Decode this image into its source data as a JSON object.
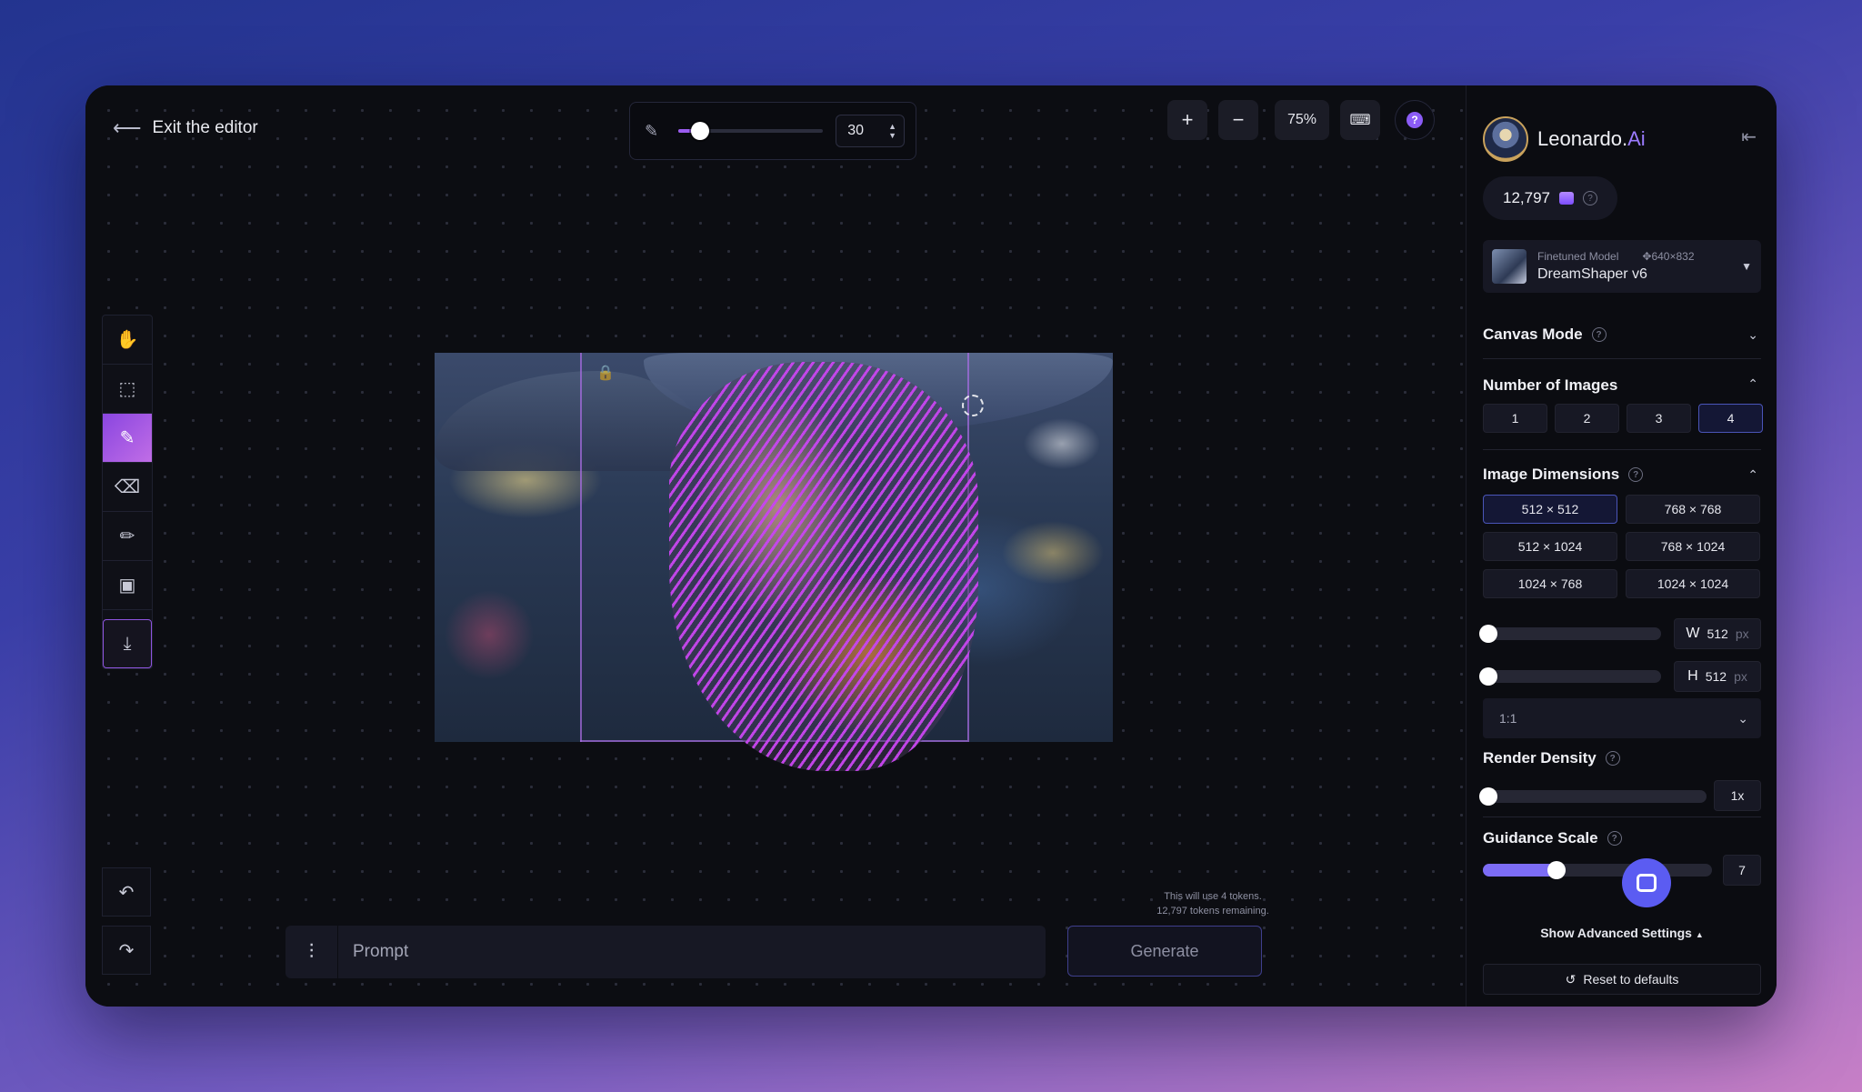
{
  "header": {
    "exit_label": "Exit the editor"
  },
  "brush": {
    "size": "30",
    "slider_fraction": 0.15
  },
  "zoom": {
    "plus": "+",
    "minus": "−",
    "level": "75%"
  },
  "toolbar": {
    "tools": [
      "hand-icon",
      "select-icon",
      "mask-brush-icon",
      "eraser-icon",
      "pencil-icon",
      "image-icon",
      "download-icon"
    ],
    "active": "mask-brush-icon",
    "undo": "undo-icon",
    "redo": "redo-icon"
  },
  "prompt": {
    "placeholder": "Prompt",
    "token_use": "This will use 4 tokens.",
    "tokens_remaining": "12,797 tokens remaining.",
    "generate_label": "Generate"
  },
  "panel": {
    "brand_main": "Leonardo.",
    "brand_accent": "Ai",
    "tokens": "12,797",
    "model": {
      "type_label": "Finetuned Model",
      "size": "640×832",
      "name": "DreamShaper v6"
    },
    "canvas_mode": "Canvas Mode",
    "number_of_images": {
      "title": "Number of Images",
      "options": [
        "1",
        "2",
        "3",
        "4"
      ],
      "selected": "4"
    },
    "image_dimensions": {
      "title": "Image Dimensions",
      "options": [
        "512 × 512",
        "768 × 768",
        "512 × 1024",
        "768 × 1024",
        "1024 × 768",
        "1024 × 1024"
      ],
      "selected": "512 × 512",
      "width_label": "W",
      "width": "512",
      "height_label": "H",
      "height": "512",
      "unit": "px",
      "aspect": "1:1"
    },
    "render_density": {
      "title": "Render Density",
      "value": "1x"
    },
    "guidance_scale": {
      "title": "Guidance Scale",
      "value": "7",
      "slider_fraction": 0.32
    },
    "advanced_label": "Show Advanced Settings",
    "reset_label": "Reset to defaults"
  },
  "colors": {
    "accent": "#8b5cf6",
    "selected_border": "#4a55b8",
    "chat": "#5b5cf2"
  }
}
